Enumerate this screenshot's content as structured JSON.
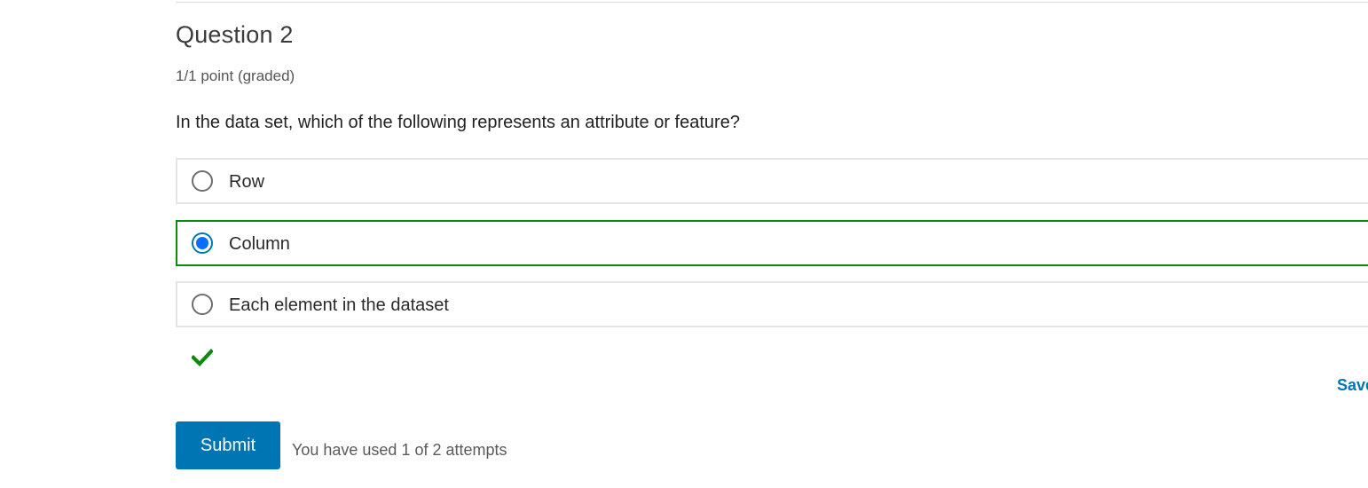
{
  "question": {
    "title": "Question 2",
    "points": "1/1 point (graded)",
    "prompt": "In the data set, which of the following represents an attribute or feature?"
  },
  "choices": [
    {
      "label": "Row",
      "selected": false
    },
    {
      "label": "Column",
      "selected": true
    },
    {
      "label": "Each element in the dataset",
      "selected": false
    }
  ],
  "feedback": {
    "status": "correct",
    "icon": "checkmark-icon",
    "color": "#0b8a0b"
  },
  "actions": {
    "save_label": "Save",
    "submit_label": "Submit",
    "attempts_text": "You have used 1 of 2 attempts"
  },
  "colors": {
    "accent": "#0075b4",
    "correct_border": "#0b8a0b",
    "radio_fill": "#0a6fff"
  }
}
